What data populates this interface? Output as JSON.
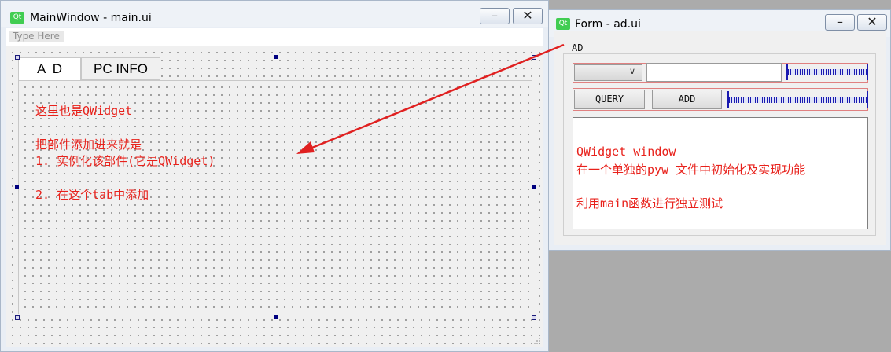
{
  "main_window": {
    "title": "MainWindow - main.ui",
    "logo": "Qt",
    "minimize_icon": "minimize-icon",
    "close_icon": "close-icon",
    "menu_placeholder": "Type Here",
    "tabs": [
      {
        "label": "A  D",
        "selected": true
      },
      {
        "label": "PC INFO",
        "selected": false
      }
    ],
    "content_lines": [
      "这里也是QWidget",
      "把部件添加进来就是",
      "1. 实例化该部件(它是QWidget)",
      "2. 在这个tab中添加"
    ]
  },
  "form_window": {
    "title": "Form - ad.ui",
    "logo": "Qt",
    "minimize_icon": "minimize-icon",
    "close_icon": "close-icon",
    "group_title": "AD",
    "combo_value": "",
    "line_edit_value": "",
    "query_button": "QUERY",
    "add_button": "ADD",
    "text_lines": [
      "QWidget window",
      "在一个单独的pyw 文件中初始化及实现功能",
      "利用main函数进行独立测试"
    ]
  },
  "colors": {
    "annotation_red": "#e8211b",
    "arrow_red": "#e02020",
    "selection_handle": "#00007f",
    "qt_green": "#41cd52",
    "desktop_gray": "#ababab"
  }
}
